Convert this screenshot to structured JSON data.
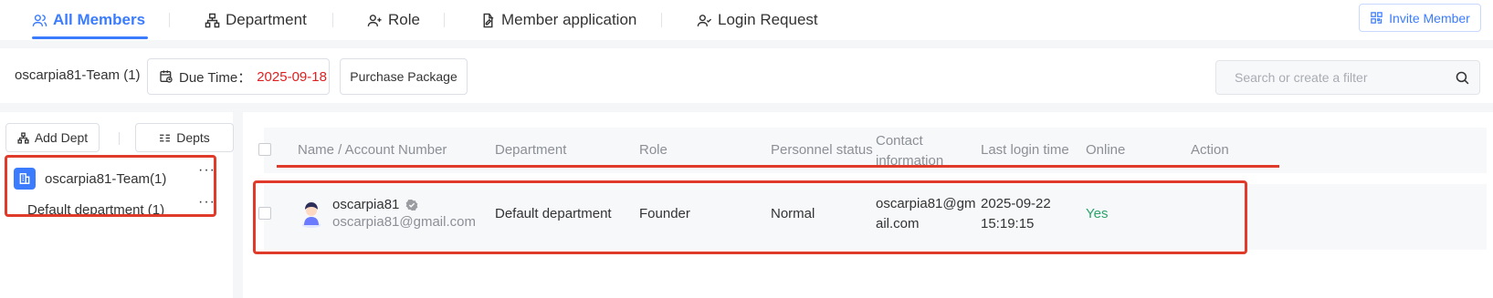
{
  "tabs": [
    {
      "label": "All Members",
      "icon": "members-icon",
      "active": true
    },
    {
      "label": "Department",
      "icon": "org-chart-icon"
    },
    {
      "label": "Role",
      "icon": "user-plus-icon"
    },
    {
      "label": "Member application",
      "icon": "edit-doc-icon"
    },
    {
      "label": "Login Request",
      "icon": "user-check-icon"
    }
  ],
  "invite_label": "Invite Member",
  "team": {
    "label": "oscarpia81-Team (1)",
    "due_label": "Due Time：",
    "due_date": "2025-09-18",
    "purchase_label": "Purchase Package"
  },
  "search": {
    "placeholder": "Search or create a filter"
  },
  "sidebar": {
    "add_dept_label": "Add Dept",
    "depts_label": "Depts",
    "team_node": "oscarpia81-Team(1)",
    "default_dept": "Default department (1)",
    "more": "···"
  },
  "table": {
    "headers": [
      "Name / Account Number",
      "Department",
      "Role",
      "Personnel status",
      "Contact information",
      "Last login time",
      "Online",
      "Action"
    ],
    "rows": [
      {
        "name": "oscarpia81",
        "account": "oscarpia81@gmail.com",
        "department": "Default department",
        "role": "Founder",
        "status": "Normal",
        "contact_line1": "oscarpia81@gm",
        "contact_line2": "ail.com",
        "login_date": "2025-09-22",
        "login_time": "15:19:15",
        "online": "Yes"
      }
    ]
  },
  "colors": {
    "accent": "#3b7cff",
    "due_date": "#e02020",
    "online": "#2aa36b",
    "annotation": "#e03a2a"
  }
}
